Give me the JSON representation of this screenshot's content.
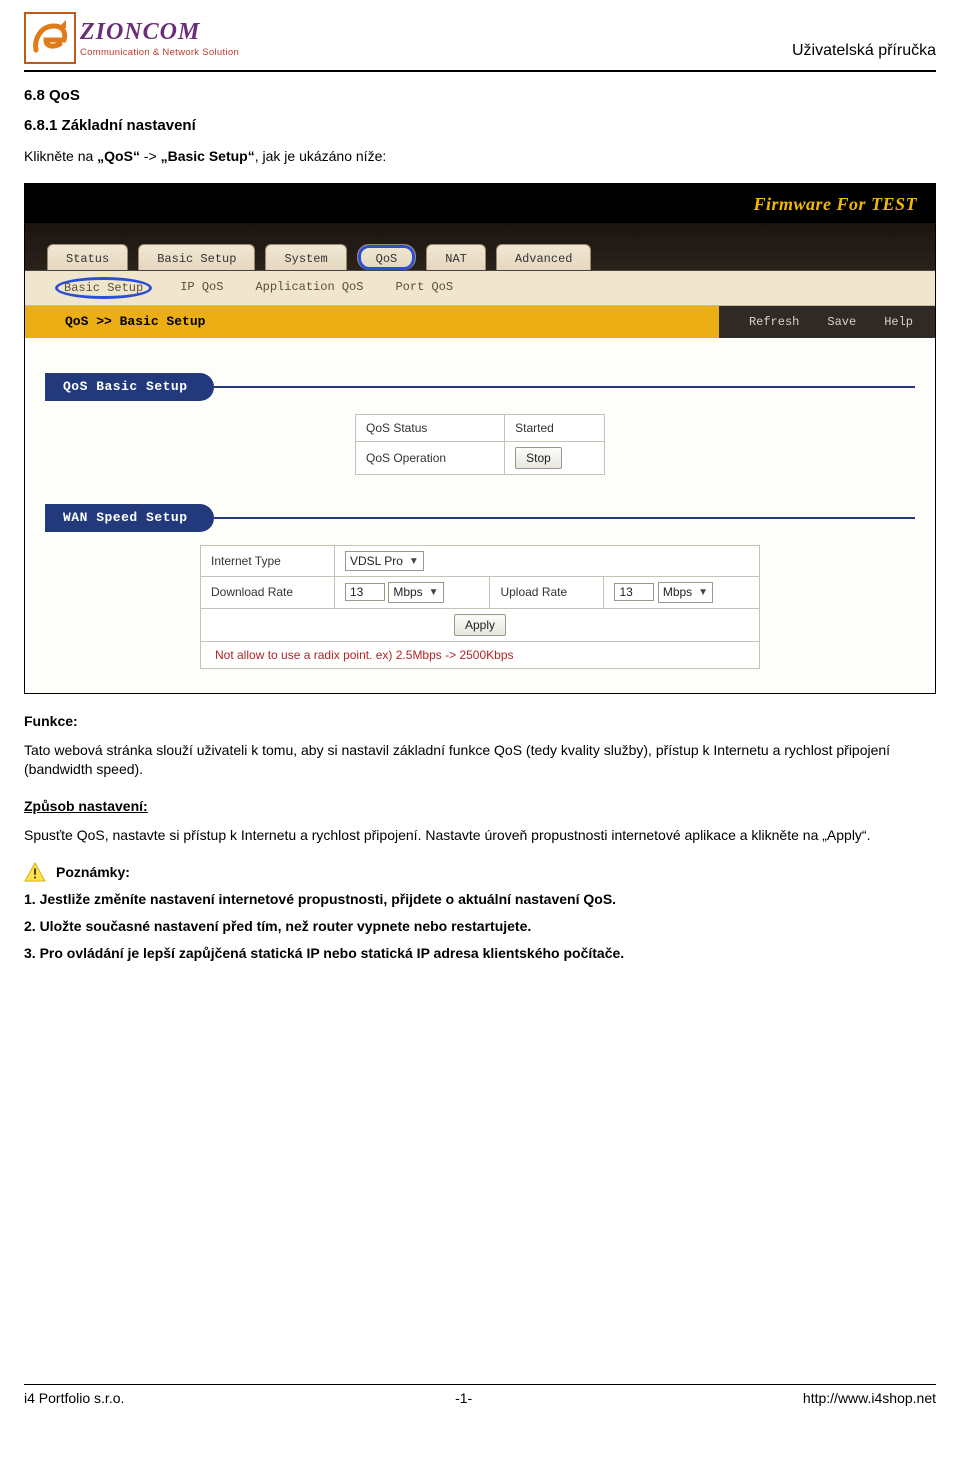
{
  "header": {
    "logo_main": "ZIONCOM",
    "logo_sub": "Communication & Network Solution",
    "doc_title": "Uživatelská příručka"
  },
  "section": {
    "h1": "6.8 QoS",
    "h2": "6.8.1 Základní nastavení",
    "intro_prefix": "Klikněte na ",
    "intro_q1": "„QoS“",
    "intro_mid": " -> ",
    "intro_q2": "„Basic Setup“",
    "intro_suffix": ", jak je ukázáno níže:"
  },
  "screenshot": {
    "firmware_label": "Firmware For TEST",
    "tabs": [
      "Status",
      "Basic Setup",
      "System",
      "QoS",
      "NAT",
      "Advanced"
    ],
    "active_tab_index": 3,
    "subnav": [
      "Basic Setup",
      "IP QoS",
      "Application QoS",
      "Port QoS"
    ],
    "active_sub_index": 0,
    "breadcrumb": "QoS >> Basic Setup",
    "actions": {
      "refresh": "Refresh",
      "save": "Save",
      "help": "Help"
    },
    "panel1_title": "QoS Basic Setup",
    "qos_status_label": "QoS Status",
    "qos_status_value": "Started",
    "qos_op_label": "QoS Operation",
    "qos_op_btn": "Stop",
    "panel2_title": "WAN Speed Setup",
    "internet_type_label": "Internet Type",
    "internet_type_value": "VDSL Pro",
    "download_label": "Download Rate",
    "download_value": "13",
    "download_unit": "Mbps",
    "upload_label": "Upload Rate",
    "upload_value": "13",
    "upload_unit": "Mbps",
    "apply_btn": "Apply",
    "note": "Not allow to use a radix point. ex) 2.5Mbps -> 2500Kbps"
  },
  "funkce": {
    "h": "Funkce:",
    "p": "Tato webová stránka slouží uživateli k tomu, aby si nastavil základní funkce QoS (tedy kvality služby), přístup k Internetu a rychlost připojení (bandwidth speed)."
  },
  "zpusob": {
    "h": "Způsob nastavení:",
    "p": "Spusťte QoS, nastavte si přístup k Internetu a rychlost připojení. Nastavte úroveň propustnosti internetové aplikace a klikněte na „Apply“."
  },
  "poznamky": {
    "h": "Poznámky:",
    "n1": "1. Jestliže změníte nastavení internetové propustnosti, přijdete o aktuální nastavení QoS.",
    "n2": "2. Uložte současné nastavení před tím, než router vypnete nebo restartujete.",
    "n3": "3. Pro ovládání je lepší zapůjčená statická IP nebo statická IP adresa klientského počítače."
  },
  "footer": {
    "left": "i4 Portfolio s.r.o.",
    "center": "-1-",
    "right": "http://www.i4shop.net"
  }
}
